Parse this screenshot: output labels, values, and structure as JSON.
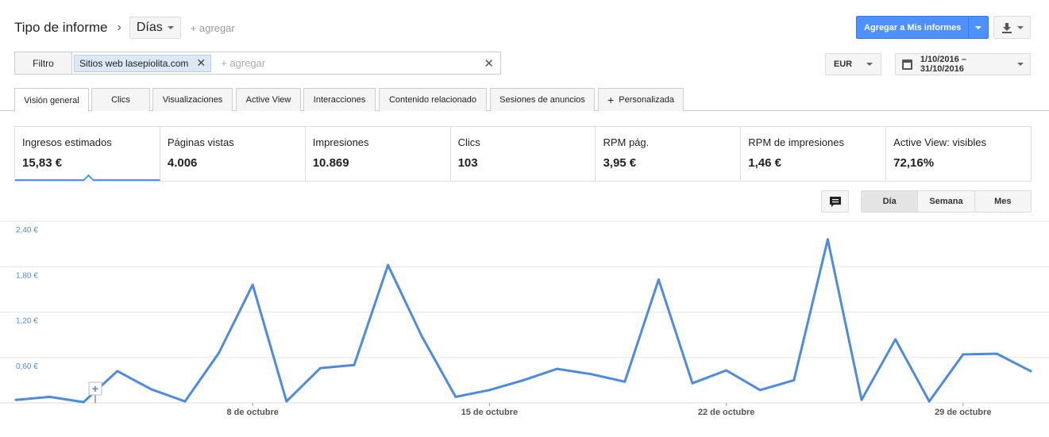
{
  "header": {
    "title": "Tipo de informe",
    "dimension": "Días",
    "add_label": "+ agregar"
  },
  "actions": {
    "add_to_reports": "Agregar a Mis informes",
    "currency": "EUR",
    "date_range": "1/10/2016 – 31/10/2016"
  },
  "filter": {
    "label": "Filtro",
    "chip_prefix": "Sitios web",
    "chip_value": "lasepiolita.com",
    "placeholder": "+ agregar"
  },
  "tabs": [
    "Visión general",
    "Clics",
    "Visualizaciones",
    "Active View",
    "Interacciones",
    "Contenido relacionado",
    "Sesiones de anuncios",
    "Personalizada"
  ],
  "metrics": [
    {
      "label": "Ingresos estimados",
      "value": "15,83 €"
    },
    {
      "label": "Páginas vistas",
      "value": "4.006"
    },
    {
      "label": "Impresiones",
      "value": "10.869"
    },
    {
      "label": "Clics",
      "value": "103"
    },
    {
      "label": "RPM pág.",
      "value": "3,95 €"
    },
    {
      "label": "RPM de impresiones",
      "value": "1,46 €"
    },
    {
      "label": "Active View: visibles",
      "value": "72,16%"
    }
  ],
  "granularity": [
    "Día",
    "Semana",
    "Mes"
  ],
  "chart_data": {
    "type": "line",
    "x": [
      1,
      2,
      3,
      4,
      5,
      6,
      7,
      8,
      9,
      10,
      11,
      12,
      13,
      14,
      15,
      16,
      17,
      18,
      19,
      20,
      21,
      22,
      23,
      24,
      25,
      26,
      27,
      28,
      29,
      30,
      31
    ],
    "x_tick_labels": [
      {
        "x": 8,
        "label": "8 de octubre"
      },
      {
        "x": 15,
        "label": "15 de octubre"
      },
      {
        "x": 22,
        "label": "22 de octubre"
      },
      {
        "x": 29,
        "label": "29 de octubre"
      }
    ],
    "values": [
      0.04,
      0.08,
      0.01,
      0.42,
      0.18,
      0.02,
      0.66,
      1.56,
      0.02,
      0.46,
      0.5,
      1.82,
      0.88,
      0.08,
      0.17,
      0.3,
      0.45,
      0.38,
      0.28,
      1.63,
      0.26,
      0.43,
      0.17,
      0.3,
      2.16,
      0.04,
      0.84,
      0.02,
      0.64,
      0.65,
      0.42
    ],
    "y_ticks": [
      "2,40 €",
      "1,80 €",
      "1,20 €",
      "0,60 €"
    ],
    "ylim": [
      0,
      2.4
    ],
    "grid": true,
    "color": "#4d8be0"
  }
}
